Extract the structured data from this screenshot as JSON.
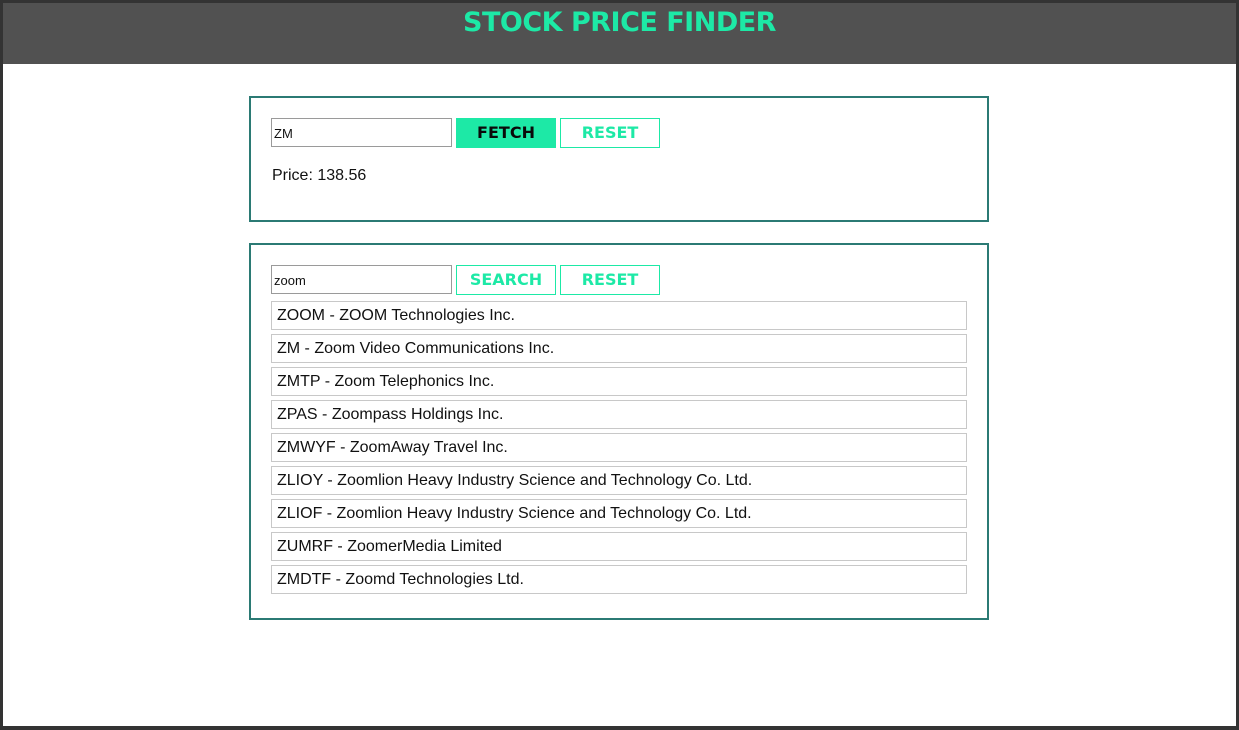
{
  "header": {
    "title": "STOCK PRICE FINDER"
  },
  "fetch_panel": {
    "input_value": "ZM",
    "fetch_label": "FETCH",
    "reset_label": "RESET",
    "price_text": "Price: 138.56"
  },
  "search_panel": {
    "input_value": "zoom",
    "search_label": "SEARCH",
    "reset_label": "RESET",
    "results": [
      "ZOOM - ZOOM Technologies Inc.",
      "ZM - Zoom Video Communications Inc.",
      "ZMTP - Zoom Telephonics Inc.",
      "ZPAS - Zoompass Holdings Inc.",
      "ZMWYF - ZoomAway Travel Inc.",
      "ZLIOY - Zoomlion Heavy Industry Science and Technology Co. Ltd.",
      "ZLIOF - Zoomlion Heavy Industry Science and Technology Co. Ltd.",
      "ZUMRF - ZoomerMedia Limited",
      "ZMDTF - Zoomd Technologies Ltd."
    ]
  },
  "colors": {
    "accent": "#1de9a6",
    "header_bg": "#515151",
    "panel_border": "#2b7a74"
  }
}
